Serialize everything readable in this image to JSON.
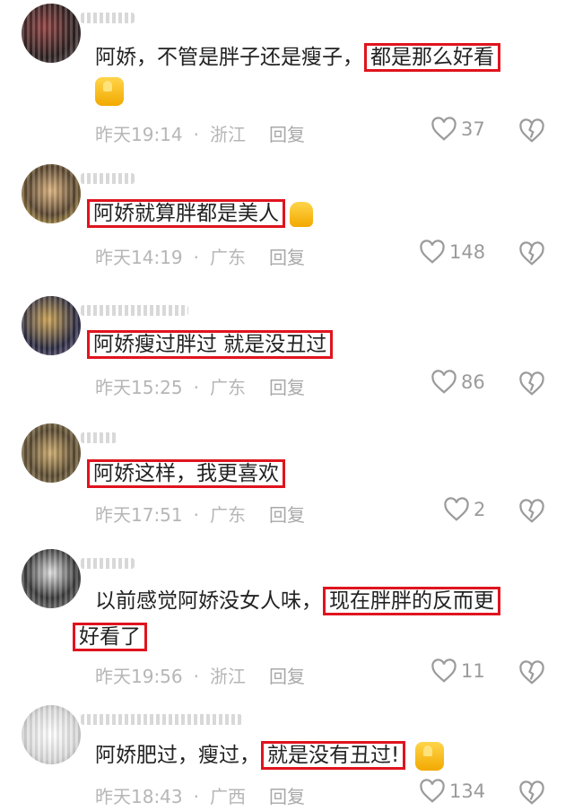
{
  "comments": [
    {
      "text_plain": "阿娇，不管是胖子还是瘦子，",
      "text_highlight": "都是那么好看",
      "emoji": "thumbs-up",
      "time": "昨天19:14",
      "location": "浙江",
      "reply_label": "回复",
      "likes": "37"
    },
    {
      "text_highlight": "阿娇就算胖都是美人",
      "emoji": "finger-heart",
      "time": "昨天14:19",
      "location": "广东",
      "reply_label": "回复",
      "likes": "148"
    },
    {
      "text_highlight": "阿娇瘦过胖过 就是没丑过",
      "time": "昨天15:25",
      "location": "广东",
      "reply_label": "回复",
      "likes": "86"
    },
    {
      "text_highlight": "阿娇这样，我更喜欢",
      "time": "昨天17:51",
      "location": "广东",
      "reply_label": "回复",
      "likes": "2"
    },
    {
      "text_plain": "以前感觉阿娇没女人味，",
      "text_highlight": "现在胖胖的反而更",
      "text_highlight_2": "好看了",
      "time": "昨天19:56",
      "location": "浙江",
      "reply_label": "回复",
      "likes": "11"
    },
    {
      "text_plain": "阿娇肥过，瘦过，",
      "text_highlight": "就是没有丑过",
      "text_suffix": "!",
      "emoji": "thumbs-up",
      "time": "昨天18:43",
      "location": "广西",
      "reply_label": "回复",
      "likes": "134"
    }
  ],
  "colors": {
    "highlight_border": "#e0141e",
    "meta_gray": "#b6b6b6"
  },
  "icons": {
    "like": "heart-outline-icon",
    "dislike": "broken-heart-icon"
  }
}
